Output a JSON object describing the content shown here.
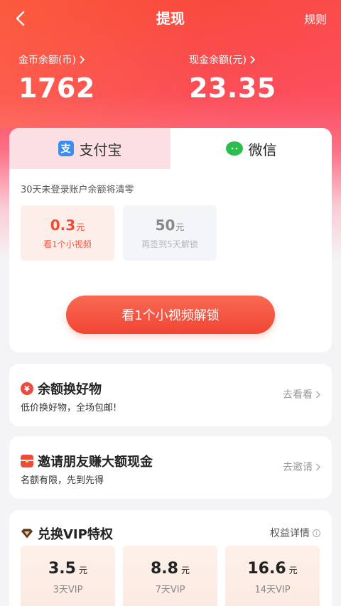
{
  "header": {
    "title": "提现",
    "rules": "规则"
  },
  "balances": {
    "coins": {
      "label": "金币余额(币)",
      "amount": "1762"
    },
    "cash": {
      "label": "现金余额(元)",
      "amount": "23.35"
    }
  },
  "withdraw": {
    "tabs": [
      {
        "label": "支付宝",
        "icon": "alipay-icon",
        "selected": false
      },
      {
        "label": "微信",
        "icon": "wechat-icon",
        "selected": true
      }
    ],
    "notice": "30天未登录账户余额将清零",
    "options": [
      {
        "amount": "0.3",
        "unit": "元",
        "sub": "看1个小视频"
      },
      {
        "amount": "50",
        "unit": "元",
        "sub": "再签到5天解锁"
      }
    ],
    "button": "看1个小视频解锁"
  },
  "promos": {
    "shop": {
      "title": "余额换好物",
      "desc": "低价换好物，全场包邮!",
      "action": "去看看"
    },
    "invite": {
      "title": "邀请朋友赚大额现金",
      "desc": "名额有限，先到先得",
      "action": "去邀请"
    }
  },
  "vip": {
    "title": "兑换VIP特权",
    "details": "权益详情",
    "options": [
      {
        "price": "3.5",
        "unit": "元",
        "days": "3天VIP"
      },
      {
        "price": "8.8",
        "unit": "元",
        "days": "7天VIP"
      },
      {
        "price": "16.6",
        "unit": "元",
        "days": "14天VIP"
      }
    ]
  },
  "colors": {
    "accent": "#f04a3c",
    "wechat": "#2bbd4e",
    "alipay": "#3b8df0"
  }
}
